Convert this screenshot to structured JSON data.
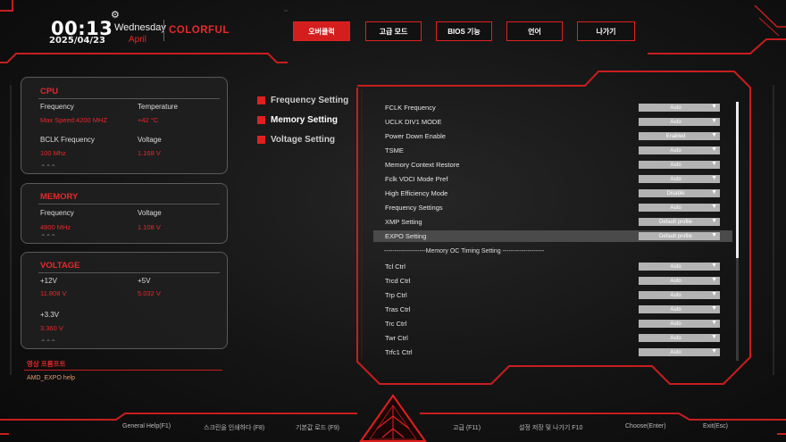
{
  "header": {
    "time": "00:13",
    "date": "2025/04/23",
    "weekday": "Wednesday",
    "month": "April",
    "brand": "COLORFUL"
  },
  "top_tabs": [
    {
      "label": "오버클럭",
      "active": true
    },
    {
      "label": "고급 모드",
      "active": false
    },
    {
      "label": "BIOS 기능",
      "active": false
    },
    {
      "label": "언어",
      "active": false
    },
    {
      "label": "나가기",
      "active": false
    }
  ],
  "cpu_panel": {
    "title": "CPU",
    "frequency_label": "Frequency",
    "frequency_value": "Max Speed:4200 MHZ",
    "temperature_label": "Temperature",
    "temperature_value": "+42 °C",
    "bclk_label": "BCLK Frequency",
    "bclk_value": "100 Mhz",
    "voltage_label": "Voltage",
    "voltage_value": "1.168 V"
  },
  "memory_panel": {
    "title": "MEMORY",
    "frequency_label": "Frequency",
    "frequency_value": "4800 MHz",
    "voltage_label": "Voltage",
    "voltage_value": "1.108 V"
  },
  "voltage_panel": {
    "title": "VOLTAGE",
    "v12_label": "+12V",
    "v12_value": "11.808 V",
    "v5_label": "+5V",
    "v5_value": "5.032 V",
    "v33_label": "+3.3V",
    "v33_value": "3.360 V"
  },
  "help": {
    "title": "영상 프롬프트",
    "text": "AMD_EXPO help"
  },
  "categories": [
    {
      "label": "Frequency Setting",
      "selected": false
    },
    {
      "label": "Memory Setting",
      "selected": true
    },
    {
      "label": "Voltage Setting",
      "selected": false
    }
  ],
  "settings": [
    {
      "name": "FCLK Frequency",
      "value": "Auto"
    },
    {
      "name": "UCLK DIV1 MODE",
      "value": "Auto"
    },
    {
      "name": "Power Down Enable",
      "value": "Enabled"
    },
    {
      "name": "TSME",
      "value": "Auto"
    },
    {
      "name": "Memory Context Restore",
      "value": "Auto"
    },
    {
      "name": "Fclk VDCI Mode Pref",
      "value": "Auto"
    },
    {
      "name": "High Efficiency Mode",
      "value": "Disable"
    },
    {
      "name": "Frequency Settings",
      "value": "Auto"
    },
    {
      "name": "XMP Setting",
      "value": "Default profile"
    },
    {
      "name": "EXPO Setting",
      "value": "Default profile",
      "selected": true
    }
  ],
  "separator_text": "--------------------Memory OC Timing Setting --------------------",
  "timings": [
    {
      "name": "Tcl Ctrl",
      "value": "Auto"
    },
    {
      "name": "Trcd Ctrl",
      "value": "Auto"
    },
    {
      "name": "Trp Ctrl",
      "value": "Auto"
    },
    {
      "name": "Tras Ctrl",
      "value": "Auto"
    },
    {
      "name": "Trc Ctrl",
      "value": "Auto"
    },
    {
      "name": "Twr Ctrl",
      "value": "Auto"
    },
    {
      "name": "Trfc1 Ctrl",
      "value": "Auto"
    }
  ],
  "footer": [
    "General Help(F1)",
    "스크린을 인쇄하다 (F8)",
    "기본값 로드 (F9)",
    "고급 (F11)",
    "설정 저장 및 나가기 F10",
    "Choose(Enter)",
    "Exit(Esc)"
  ],
  "colors": {
    "accent": "#e02020",
    "value_red": "#e8282a",
    "dropdown_bg": "#b3b3b3",
    "selected_row": "#4a4a4a"
  },
  "icons": {
    "settings": "gear-icon",
    "dropdown": "triangle-down-icon",
    "category_marker": "red-square-icon",
    "emblem": "triangle-emblem-icon"
  }
}
